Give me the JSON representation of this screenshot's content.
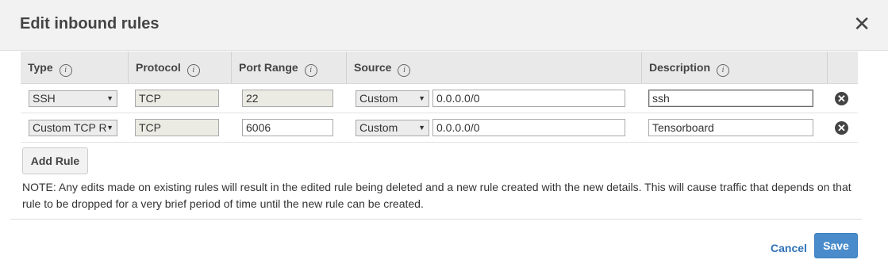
{
  "dialog": {
    "title": "Edit inbound rules",
    "close_glyph": "✕"
  },
  "table": {
    "headers": {
      "type": "Type",
      "protocol": "Protocol",
      "port_range": "Port Range",
      "source": "Source",
      "description": "Description"
    },
    "info_glyph": "i",
    "rows": [
      {
        "type": "SSH",
        "protocol": "TCP",
        "port_range": "22",
        "source_type": "Custom",
        "source_cidr": "0.0.0.0/0",
        "description": "ssh"
      },
      {
        "type": "Custom TCP R",
        "protocol": "TCP",
        "port_range": "6006",
        "source_type": "Custom",
        "source_cidr": "0.0.0.0/0",
        "description": "Tensorboard"
      }
    ],
    "remove_glyph": "✕",
    "dropdown_arrow": "▼"
  },
  "add_rule_label": "Add Rule",
  "note": "NOTE: Any edits made on existing rules will result in the edited rule being deleted and a new rule created with the new details. This will cause traffic that depends on that rule to be dropped for a very brief period of time until the new rule can be created.",
  "footer": {
    "cancel_label": "Cancel",
    "save_label": "Save"
  },
  "colors": {
    "header_bg": "#f2f2f2",
    "primary_button": "#4a8ccb",
    "link": "#2e72b8"
  },
  "icons": {
    "close": "close-icon",
    "info": "info-icon",
    "remove": "remove-circle-icon",
    "dropdown": "chevron-down-icon"
  }
}
